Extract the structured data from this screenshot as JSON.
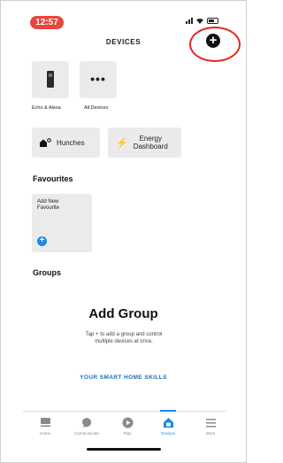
{
  "status_bar": {
    "time": "12:57"
  },
  "header": {
    "title": "DEVICES",
    "add_icon": "plus-icon"
  },
  "categories": [
    {
      "label": "Echo & Alexa",
      "icon": "echo-device-icon"
    },
    {
      "label": "All Devices",
      "icon": "more-dots-icon"
    }
  ],
  "quick_actions": {
    "hunches": {
      "label": "Hunches",
      "icon": "house-sparkle-icon"
    },
    "energy": {
      "label_line1": "Energy",
      "label_line2": "Dashboard",
      "icon": "lightning-bolt-icon"
    }
  },
  "favourites": {
    "heading": "Favourites",
    "add_line1": "Add New",
    "add_line2": "Favourite"
  },
  "groups": {
    "heading": "Groups",
    "add_group_title": "Add Group",
    "description_line1": "Tap + to add a group and control",
    "description_line2": "multiple devices at once."
  },
  "skills_link": "YOUR SMART HOME SKILLS",
  "bottom_nav": [
    {
      "label": "Home",
      "icon": "home-feed-icon"
    },
    {
      "label": "Communicate",
      "icon": "chat-bubble-icon"
    },
    {
      "label": "Play",
      "icon": "play-icon"
    },
    {
      "label": "Devices",
      "icon": "devices-icon",
      "active": true
    },
    {
      "label": "More",
      "icon": "menu-icon"
    }
  ],
  "colors": {
    "accent": "#1e88e5",
    "highlight_ring": "#e8261c",
    "status_time_bg": "#e8453c",
    "tile_bg": "#ebebeb"
  }
}
